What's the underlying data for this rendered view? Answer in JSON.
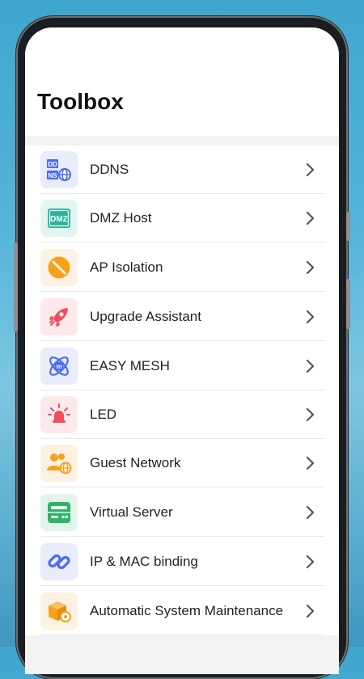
{
  "page_title": "Toolbox",
  "chevron_icon": "chevron-right-icon",
  "items": [
    {
      "label": "DDNS",
      "icon": "ddns-icon",
      "bg": "#e8ecfb",
      "color": "#4a6cf0"
    },
    {
      "label": "DMZ Host",
      "icon": "dmz-icon",
      "bg": "#e3f5f1",
      "color": "#2bb59d"
    },
    {
      "label": "AP Isolation",
      "icon": "ap-isolation-icon",
      "bg": "#fdf1e3",
      "color": "#f6a11a"
    },
    {
      "label": "Upgrade Assistant",
      "icon": "rocket-icon",
      "bg": "#fde9ec",
      "color": "#f04c5c"
    },
    {
      "label": "EASY MESH",
      "icon": "mesh-icon",
      "bg": "#e8ecfb",
      "color": "#4a6cf0"
    },
    {
      "label": "LED",
      "icon": "led-bulb-icon",
      "bg": "#fde9ec",
      "color": "#f04c5c"
    },
    {
      "label": "Guest Network",
      "icon": "guest-network-icon",
      "bg": "#fdf1e3",
      "color": "#f6a11a"
    },
    {
      "label": "Virtual Server",
      "icon": "virtual-server-icon",
      "bg": "#e3f5ea",
      "color": "#2bb565"
    },
    {
      "label": "IP & MAC binding",
      "icon": "link-icon",
      "bg": "#e8ecfb",
      "color": "#4a6cf0"
    },
    {
      "label": "Automatic System Maintenance",
      "icon": "maintenance-box-icon",
      "bg": "#fdf1e3",
      "color": "#f6a11a"
    }
  ]
}
